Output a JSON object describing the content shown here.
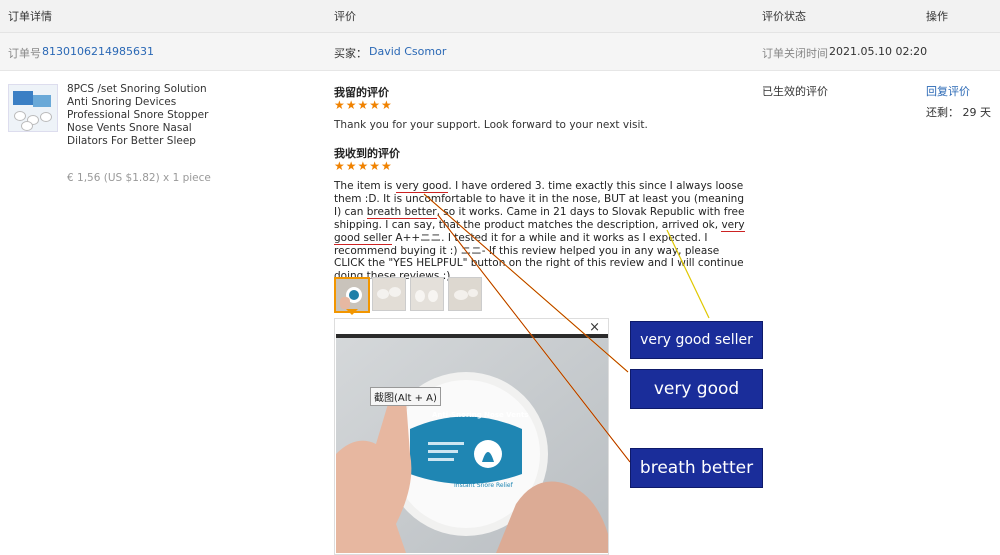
{
  "header": {
    "col_order": "订单详情",
    "col_review": "评价",
    "col_status": "评价状态",
    "col_action": "操作"
  },
  "order": {
    "number_label": "订单号",
    "number": "8130106214985631",
    "buyer_label": "买家：",
    "buyer": "David Csomor",
    "closed_label": "订单关闭时间",
    "closed_time": "2021.05.10 02:20"
  },
  "product": {
    "name": "8PCS /set Snoring Solution Anti Snoring Devices Professional Snore Stopper Nose Vents Snore Nasal Dilators For Better Sleep",
    "price": "€ 1,56 (US $1.82) x 1 piece"
  },
  "my_review": {
    "title": "我留的评价",
    "stars": "★★★★★",
    "text": "Thank you for your support. Look forward to your next visit."
  },
  "received_review": {
    "title": "我收到的评价",
    "stars": "★★★★★",
    "p1": "The item is ",
    "h1": "very good",
    "p2": ". I have ordered 3. time exactly this since I always loose them :D. It is uncomfortable to have it in the nose, BUT at least you (meaning I) can ",
    "h2": "breath better",
    "p3": ", so it works. Came in 21 days to Slovak Republic with free shipping. I can say, that the product matches the description, arrived ok, ",
    "h3": "very good seller",
    "p4": " A++ニニ. I tested it for a while and it works as I expected. I recommend buying it :) ニニ- If this review helped you in any way, please CLICK the \"YES HELPFUL\" button on the right of this review and I will continue doing these reviews :)"
  },
  "preview": {
    "close_glyph": "×",
    "tooltip": "截图(Alt + A)",
    "label_title": "Anti-Snoring Nose Vents",
    "label_sub": "Instant Snore Relief"
  },
  "callouts": {
    "seller": "very good seller",
    "good": "very good",
    "breath": "breath better"
  },
  "status": {
    "text": "已生效的评价"
  },
  "action": {
    "reply": "回复评价",
    "remaining": "还剩： 29 天"
  },
  "colors": {
    "link": "#2a68b5",
    "star": "#f08200",
    "callout_bg": "#1a2d9a"
  }
}
